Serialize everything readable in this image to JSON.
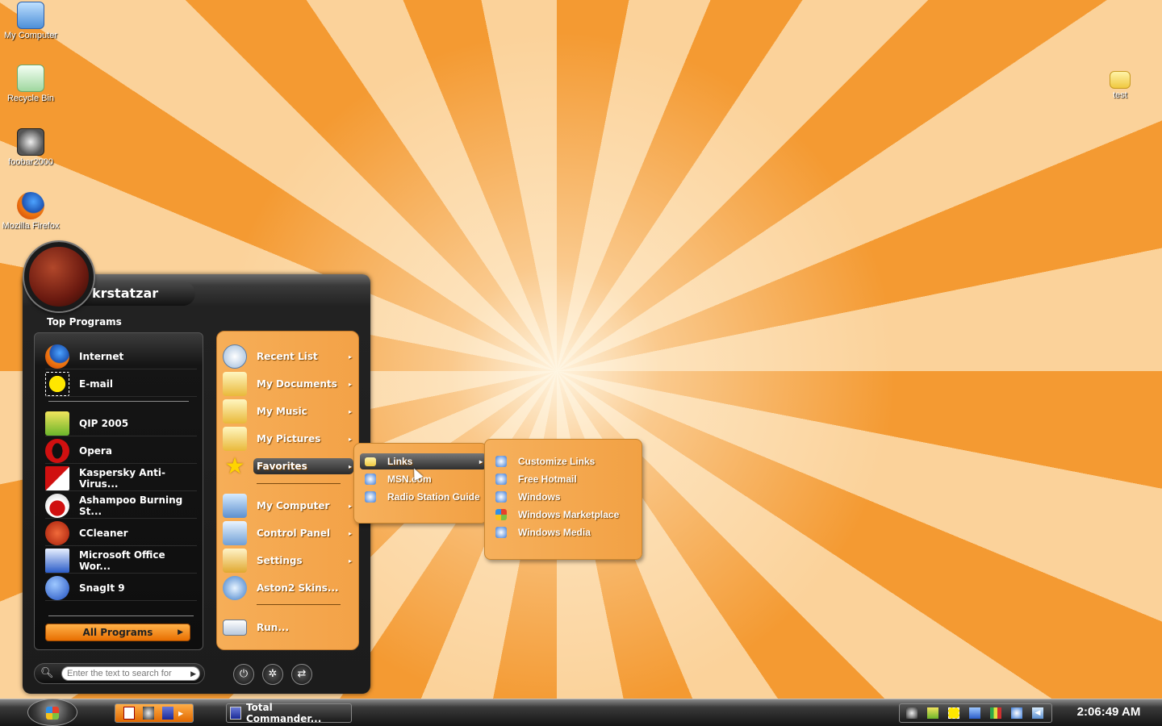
{
  "desktop": {
    "icons": [
      {
        "label": "My Computer"
      },
      {
        "label": "Recycle Bin"
      },
      {
        "label": "foobar2000"
      },
      {
        "label": "Mozilla Firefox"
      },
      {
        "label": "test"
      }
    ]
  },
  "start_menu": {
    "username": "krstatzar",
    "section_label": "Top Programs",
    "pinned": [
      {
        "label": "Internet",
        "icon": "firefox-icon"
      },
      {
        "label": "E-mail",
        "icon": "batman-mail-icon"
      }
    ],
    "recent": [
      {
        "label": "QIP 2005",
        "icon": "qip-icon"
      },
      {
        "label": "Opera",
        "icon": "opera-icon"
      },
      {
        "label": "Kaspersky Anti-Virus...",
        "icon": "kaspersky-icon"
      },
      {
        "label": "Ashampoo Burning St...",
        "icon": "ashampoo-icon"
      },
      {
        "label": "CCleaner",
        "icon": "ccleaner-icon"
      },
      {
        "label": "Microsoft Office Wor...",
        "icon": "word-icon"
      },
      {
        "label": "SnagIt 9",
        "icon": "snagit-icon"
      }
    ],
    "all_programs": "All Programs",
    "right_items": [
      {
        "label": "Recent List",
        "arrow": "▸"
      },
      {
        "label": "My Documents",
        "arrow": "▸"
      },
      {
        "label": "My Music",
        "arrow": "▸"
      },
      {
        "label": "My Pictures",
        "arrow": "▸"
      },
      {
        "label": "Favorites",
        "arrow": "▸"
      },
      {
        "label": "My Computer",
        "arrow": "▸"
      },
      {
        "label": "Control Panel",
        "arrow": "▸"
      },
      {
        "label": "Settings",
        "arrow": "▸"
      },
      {
        "label": "Aston2 Skins...",
        "arrow": ""
      },
      {
        "label": "Run...",
        "arrow": ""
      }
    ],
    "search_placeholder": "Enter the text to search for"
  },
  "favorites_menu": {
    "items": [
      {
        "label": "Links",
        "arrow": "▸"
      },
      {
        "label": "MSN.com",
        "arrow": ""
      },
      {
        "label": "Radio Station Guide",
        "arrow": ""
      }
    ]
  },
  "links_menu": {
    "items": [
      {
        "label": "Customize Links"
      },
      {
        "label": "Free Hotmail"
      },
      {
        "label": "Windows"
      },
      {
        "label": "Windows Marketplace"
      },
      {
        "label": "Windows Media"
      }
    ]
  },
  "taskbar": {
    "task_label": "Total Commander...",
    "clock": "2:06:49 AM"
  },
  "colors": {
    "accent": "#f3a247",
    "menu_dark": "#1c1c1c",
    "highlight": "#e86e00"
  }
}
